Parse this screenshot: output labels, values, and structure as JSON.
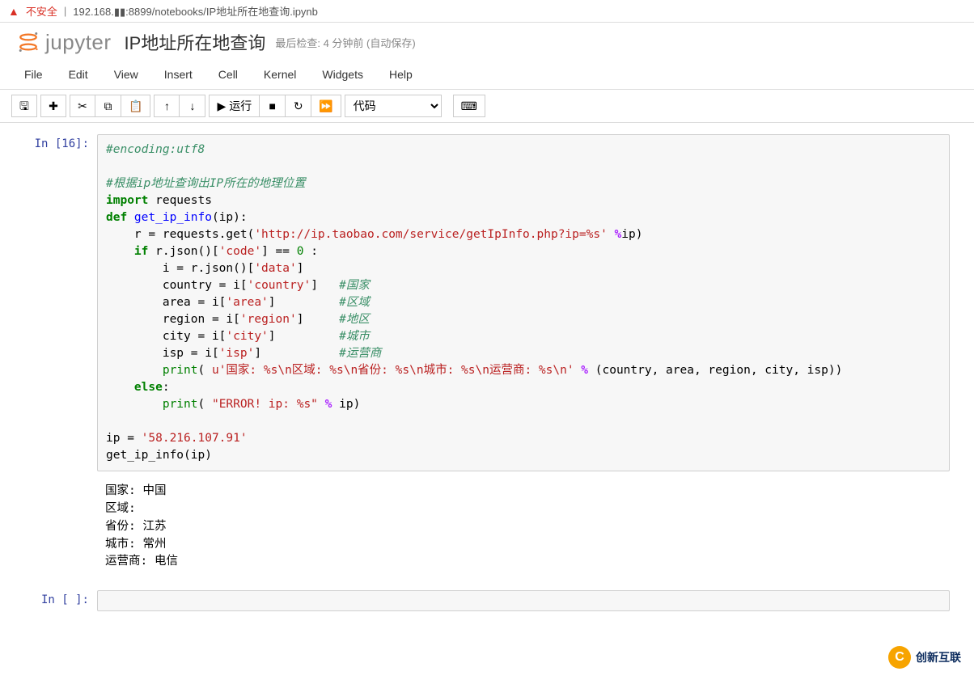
{
  "browser": {
    "unsafe_label": "不安全",
    "url": "192.168.▮▮:8899/notebooks/IP地址所在地查询.ipynb"
  },
  "header": {
    "brand": "jupyter",
    "notebook_name": "IP地址所在地查询",
    "checkpoint": "最后检查: 4 分钟前  (自动保存)"
  },
  "menu": {
    "file": "File",
    "edit": "Edit",
    "view": "View",
    "insert": "Insert",
    "cell": "Cell",
    "kernel": "Kernel",
    "widgets": "Widgets",
    "help": "Help"
  },
  "toolbar": {
    "run_label": "运行",
    "celltype_selected": "代码"
  },
  "cells": {
    "in16_prompt": "In  [16]:",
    "empty_prompt": "In  [ ]:",
    "output_text": "国家: 中国\n区域: \n省份: 江苏\n城市: 常州\n运营商: 电信",
    "code": {
      "l1": "#encoding:utf8",
      "l2": "#根据ip地址查询出IP所在的地理位置",
      "l3_import": "import",
      "l3_requests": " requests",
      "l4_def": "def",
      "l4_name": " get_ip_info",
      "l4_rest": "(ip):",
      "l5a": "    r = requests.get(",
      "l5b": "'http://ip.taobao.com/service/getIpInfo.php?ip=%s'",
      "l5c": " %",
      "l5d": "ip)",
      "l6_if": "    if",
      "l6_a": " r.json()[",
      "l6_s": "'code'",
      "l6_b": "] == ",
      "l6_n": "0",
      "l6_c": " :",
      "l7_a": "        i = r.json()[",
      "l7_s": "'data'",
      "l7_b": "]",
      "l8_a": "        country = i[",
      "l8_s": "'country'",
      "l8_b": "]   ",
      "l8_c": "#国家",
      "l9_a": "        area = i[",
      "l9_s": "'area'",
      "l9_b": "]         ",
      "l9_c": "#区域",
      "l10_a": "        region = i[",
      "l10_s": "'region'",
      "l10_b": "]     ",
      "l10_c": "#地区",
      "l11_a": "        city = i[",
      "l11_s": "'city'",
      "l11_b": "]         ",
      "l11_c": "#城市",
      "l12_a": "        isp = i[",
      "l12_s": "'isp'",
      "l12_b": "]           ",
      "l12_c": "#运营商",
      "l13_a": "        print",
      "l13_b": "( ",
      "l13_s": "u'国家: %s\\n区域: %s\\n省份: %s\\n城市: %s\\n运营商: %s\\n'",
      "l13_op": " %",
      "l13_c": " (country, area, region, city, isp))",
      "l14_else": "    else",
      "l14_b": ":",
      "l15_a": "        print",
      "l15_b": "( ",
      "l15_s": "\"ERROR! ip: %s\"",
      "l15_op": " %",
      "l15_c": " ip)",
      "l16_a": "ip = ",
      "l16_s": "'58.216.107.91'",
      "l17": "get_ip_info(ip)"
    }
  },
  "watermark": {
    "badge": "C",
    "text": "创新互联"
  }
}
